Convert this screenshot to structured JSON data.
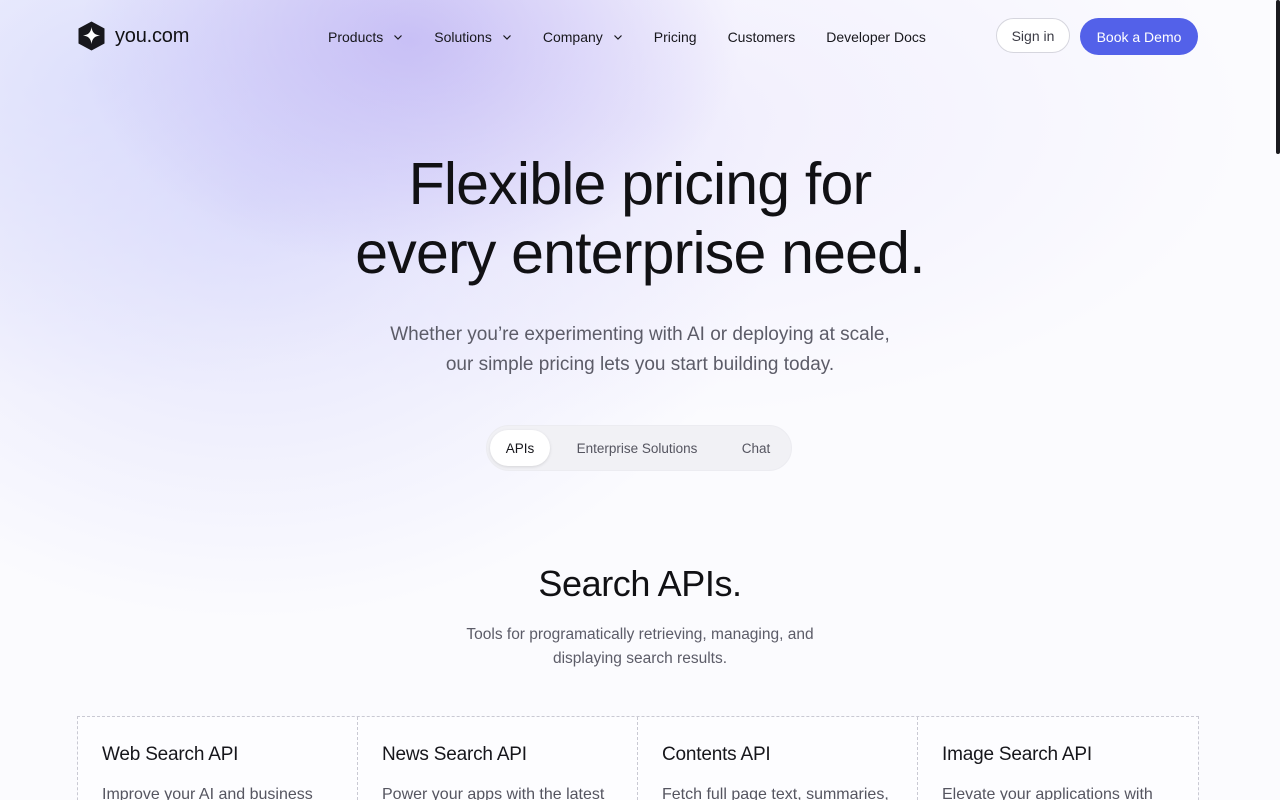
{
  "header": {
    "logo_text": "you.com",
    "logo_icon": "you-com-logo-icon",
    "nav": [
      {
        "label": "Products",
        "has_dropdown": true
      },
      {
        "label": "Solutions",
        "has_dropdown": true
      },
      {
        "label": "Company",
        "has_dropdown": true
      },
      {
        "label": "Pricing",
        "has_dropdown": false
      },
      {
        "label": "Customers",
        "has_dropdown": false
      },
      {
        "label": "Developer Docs",
        "has_dropdown": false
      }
    ],
    "signin_label": "Sign in",
    "demo_label": "Book a Demo"
  },
  "hero": {
    "title_line1": "Flexible pricing for",
    "title_line2": "every enterprise need.",
    "sub_line1": "Whether you’re experimenting with AI or deploying at scale,",
    "sub_line2": "our simple pricing lets you start building today."
  },
  "tabs": {
    "items": [
      "APIs",
      "Enterprise Solutions",
      "Chat"
    ],
    "active": "APIs"
  },
  "section": {
    "title": "Search APIs.",
    "sub_line1": "Tools for programatically retrieving, managing, and",
    "sub_line2": "displaying search results."
  },
  "cards": [
    {
      "title": "Web Search API",
      "desc": "Improve your AI and business"
    },
    {
      "title": "News Search API",
      "desc": "Power your apps with the latest"
    },
    {
      "title": "Contents API",
      "desc": "Fetch full page text, summaries,"
    },
    {
      "title": "Image Search API",
      "desc": "Elevate your applications with"
    }
  ],
  "colors": {
    "accent": "#5361e9",
    "text": "#111114",
    "muted": "#5c5c68"
  }
}
